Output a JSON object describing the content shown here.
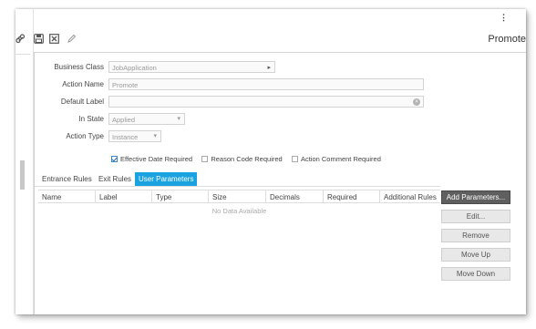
{
  "header": {
    "title": "Promote",
    "more_menu": "⋮"
  },
  "toolbar": {
    "icons": [
      "link-icon",
      "save-icon",
      "close-box-icon",
      "pencil-icon"
    ]
  },
  "form": {
    "business_class": {
      "label": "Business Class",
      "value": "JobApplication"
    },
    "action_name": {
      "label": "Action Name",
      "value": "Promote"
    },
    "default_label": {
      "label": "Default Label",
      "value": ""
    },
    "in_state": {
      "label": "In State",
      "value": "Applied"
    },
    "action_type": {
      "label": "Action Type",
      "value": "Instance"
    },
    "checkboxes": [
      {
        "label": "Effective Date Required",
        "checked": true
      },
      {
        "label": "Reason Code Required",
        "checked": false
      },
      {
        "label": "Action Comment Required",
        "checked": false
      }
    ]
  },
  "tabs": [
    {
      "label": "Entrance Rules",
      "active": false
    },
    {
      "label": "Exit Rules",
      "active": false
    },
    {
      "label": "User Parameters",
      "active": true
    }
  ],
  "table": {
    "columns": [
      "Name",
      "Label",
      "Type",
      "Size",
      "Decimals",
      "Required",
      "Additional Rules"
    ],
    "empty_text": "No Data Available"
  },
  "buttons": {
    "add_parameters": "Add Parameters...",
    "edit": "Edit...",
    "remove": "Remove",
    "move_up": "Move Up",
    "move_down": "Move Down"
  },
  "colors": {
    "tab_active": "#1aa3e0",
    "primary_button": "#5f5f5f",
    "checkbox_accent": "#2a6fb0"
  }
}
